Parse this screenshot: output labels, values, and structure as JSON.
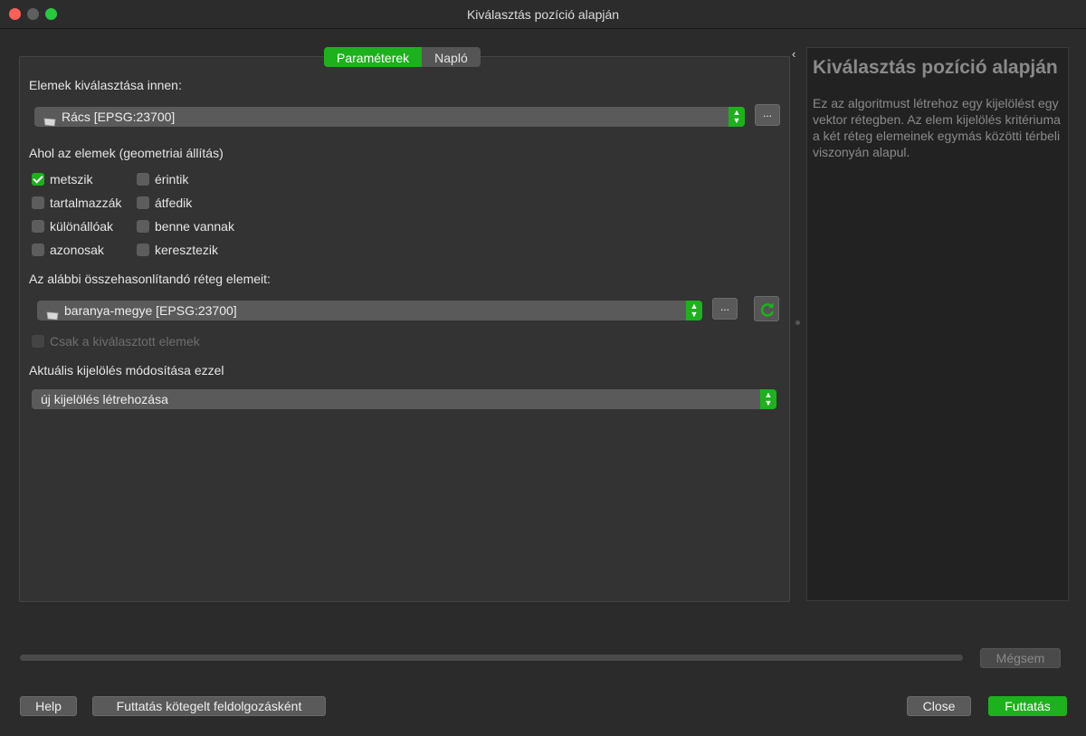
{
  "window": {
    "title": "Kiválasztás pozíció alapján"
  },
  "tabs": [
    {
      "label": "Paraméterek",
      "active": true
    },
    {
      "label": "Napló",
      "active": false
    }
  ],
  "params": {
    "select_from_label": "Elemek kiválasztása innen:",
    "select_from_value": "Rács [EPSG:23700]",
    "predicate_label": "Ahol az elemek (geometriai állítás)",
    "predicates": [
      {
        "label": "metszik",
        "checked": true
      },
      {
        "label": "érintik",
        "checked": false
      },
      {
        "label": "tartalmazzák",
        "checked": false
      },
      {
        "label": "átfedik",
        "checked": false
      },
      {
        "label": "különállóak",
        "checked": false
      },
      {
        "label": "benne vannak",
        "checked": false
      },
      {
        "label": "azonosak",
        "checked": false
      },
      {
        "label": "keresztezik",
        "checked": false
      }
    ],
    "compare_label": "Az alábbi összehasonlítandó réteg elemeit:",
    "compare_value": "baranya-megye [EPSG:23700]",
    "selected_only_label": "Csak a kiválasztott elemek",
    "modify_label": "Aktuális kijelölés módosítása ezzel",
    "modify_value": "új kijelölés létrehozása",
    "ellipsis": "..."
  },
  "help": {
    "title": "Kiválasztás pozíció alapján",
    "text": "Ez az algoritmust létrehoz egy kijelölést egy vektor rétegben. Az elem kijelölés kritériuma a két réteg elemeinek egymás közötti térbeli viszonyán alapul."
  },
  "buttons": {
    "cancel": "Mégsem",
    "help": "Help",
    "batch": "Futtatás kötegelt feldolgozásként",
    "close": "Close",
    "run": "Futtatás"
  },
  "colors": {
    "accent": "#1db11d",
    "panel": "#333333",
    "help_bg": "#222222"
  }
}
